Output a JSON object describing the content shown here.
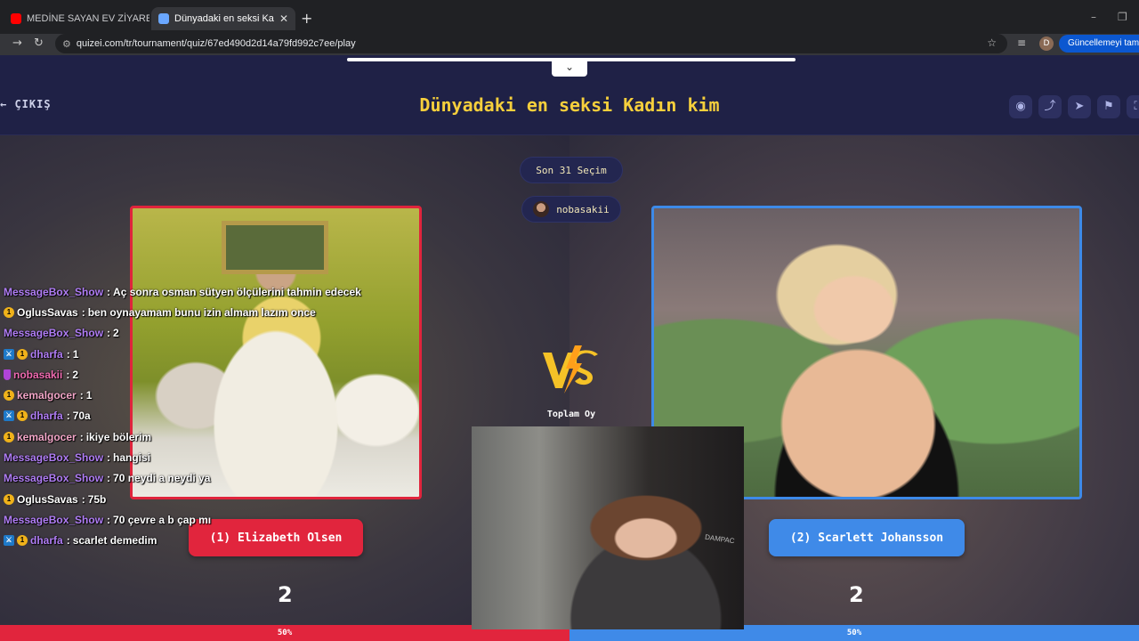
{
  "browser": {
    "tabs": [
      {
        "title": "MEDİNE SAYAN EV ZİYARETİ - Y",
        "active": false,
        "favicon_color": "#ff0000"
      },
      {
        "title": "Dünyadaki en seksi Kadın kim",
        "active": true,
        "favicon_color": "#6aa7ff"
      }
    ],
    "new_tab": "+",
    "address": "quizei.com/tr/tournament/quiz/67ed490d2d14a79fd992c7ee/play",
    "profile_initial": "D",
    "update_button": "Güncellemeyi tamamla"
  },
  "header": {
    "exit_label": "← ÇIKIŞ",
    "title": "Dünyadaki en seksi Kadın kim",
    "collapse_icon": "⌄"
  },
  "round": {
    "stage_label": "Son 31 Seçim",
    "player_name": "nobasakii",
    "total_votes_label": "Toplam Oy"
  },
  "choices": {
    "left": {
      "label": "(1) Elizabeth Olsen",
      "votes": "2",
      "percent_label": "50%",
      "percent": 50,
      "color": "#e1253d"
    },
    "right": {
      "label": "(2) Scarlett Johansson",
      "votes": "2",
      "percent_label": "50%",
      "percent": 50,
      "color": "#3f8ae8"
    }
  },
  "chat": [
    {
      "badges": [],
      "user": "MessageBox_Show",
      "color": "#b07df5",
      "text": "Aç sonra osman sütyen ölçülerini tahmin edecek"
    },
    {
      "badges": [
        "sub"
      ],
      "user": "OglusSavas",
      "color": "#ffffff",
      "text": "ben oynayamam bunu izin almam lazım once"
    },
    {
      "badges": [],
      "user": "MessageBox_Show",
      "color": "#b07df5",
      "text": "2"
    },
    {
      "badges": [
        "mod",
        "sub"
      ],
      "user": "dharfa",
      "color": "#b07df5",
      "text": "1"
    },
    {
      "badges": [
        "bc"
      ],
      "user": "nobasakii",
      "color": "#f06bb0",
      "text": "2"
    },
    {
      "badges": [
        "sub"
      ],
      "user": "kemalgocer",
      "color": "#f3a6c8",
      "text": "1"
    },
    {
      "badges": [
        "mod",
        "sub"
      ],
      "user": "dharfa",
      "color": "#b07df5",
      "text": "70a"
    },
    {
      "badges": [
        "sub"
      ],
      "user": "kemalgocer",
      "color": "#f3a6c8",
      "text": "ikiye bölerim"
    },
    {
      "badges": [],
      "user": "MessageBox_Show",
      "color": "#b07df5",
      "text": "hangisi"
    },
    {
      "badges": [],
      "user": "MessageBox_Show",
      "color": "#b07df5",
      "text": "70 neydi a neydi ya"
    },
    {
      "badges": [
        "sub"
      ],
      "user": "OglusSavas",
      "color": "#ffffff",
      "text": "75b"
    },
    {
      "badges": [],
      "user": "MessageBox_Show",
      "color": "#b07df5",
      "text": "70 çevre a b çap mı"
    },
    {
      "badges": [
        "mod",
        "sub"
      ],
      "user": "dharfa",
      "color": "#b07df5",
      "text": "scarlet demedim"
    }
  ],
  "webcam": {
    "chair_brand": "DAMPAC"
  }
}
